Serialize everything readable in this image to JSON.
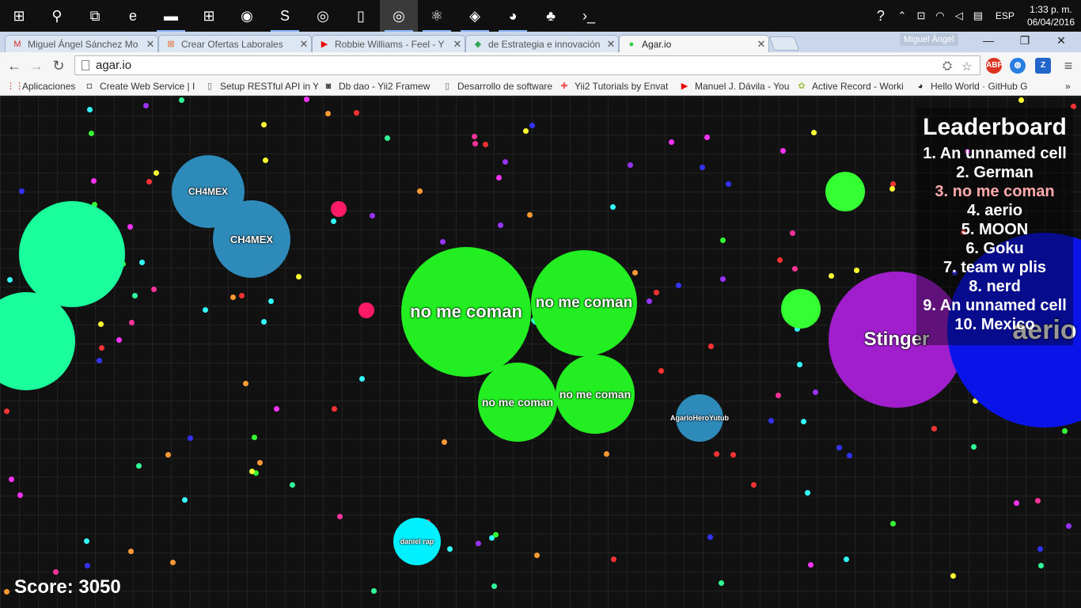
{
  "taskbar": {
    "apps": [
      {
        "name": "windows-start-icon",
        "glyph": "⊞",
        "open": false
      },
      {
        "name": "search-icon",
        "glyph": "⚲",
        "open": false
      },
      {
        "name": "task-view-icon",
        "glyph": "⧉",
        "open": false
      },
      {
        "name": "edge-icon",
        "glyph": "e",
        "open": false
      },
      {
        "name": "file-explorer-icon",
        "glyph": "▬",
        "open": true
      },
      {
        "name": "store-icon",
        "glyph": "⊞",
        "open": false
      },
      {
        "name": "firefox-icon",
        "glyph": "◉",
        "open": false
      },
      {
        "name": "sublime-icon",
        "glyph": "S",
        "open": true
      },
      {
        "name": "chrome-icon",
        "glyph": "◎",
        "open": false
      },
      {
        "name": "document-icon",
        "glyph": "▯",
        "open": false
      },
      {
        "name": "chrome-active-icon",
        "glyph": "◎",
        "open": true
      },
      {
        "name": "atom-icon",
        "glyph": "⚛",
        "open": true
      },
      {
        "name": "mysql-workbench-icon",
        "glyph": "◈",
        "open": true
      },
      {
        "name": "github-desktop-icon",
        "glyph": "◕",
        "open": true
      },
      {
        "name": "clover-icon",
        "glyph": "♣",
        "open": false
      },
      {
        "name": "powershell-icon",
        "glyph": "›_",
        "open": false
      }
    ],
    "lang": "ESP",
    "time": "1:33 p. m.",
    "date": "06/04/2016"
  },
  "tabs": [
    {
      "title": "Miguel Ángel Sánchez Mo",
      "icon": "M",
      "color": "#d93025",
      "active": false
    },
    {
      "title": "Crear Ofertas Laborales",
      "icon": "⊠",
      "color": "#e8733a",
      "active": false
    },
    {
      "title": "Robbie Williams - Feel - Y",
      "icon": "▶",
      "color": "#e00",
      "active": false
    },
    {
      "title": "de Estrategia e innovación",
      "icon": "◆",
      "color": "#34a853",
      "active": false
    },
    {
      "title": "Agar.io",
      "icon": "●",
      "color": "#2ecc40",
      "active": true
    }
  ],
  "profile_name": "Miguel Ángel",
  "url": "agar.io",
  "bookmarks": [
    {
      "label": "Aplicaciones",
      "icon": "⋮⋮",
      "color": "#d93025"
    },
    {
      "label": "Create Web Service | I",
      "icon": "◘",
      "color": "#666"
    },
    {
      "label": "Setup RESTful API in Y",
      "icon": "▯",
      "color": "#666"
    },
    {
      "label": "Db dao - Yii2 Framew",
      "icon": "◙",
      "color": "#333"
    },
    {
      "label": "Desarrollo de software",
      "icon": "▯",
      "color": "#666"
    },
    {
      "label": "Yii2 Tutorials by Envat",
      "icon": "✚",
      "color": "#e55"
    },
    {
      "label": "Manuel J. Dávila - You",
      "icon": "▶",
      "color": "#e00"
    },
    {
      "label": "Active Record - Worki",
      "icon": "✿",
      "color": "#a3c24a"
    },
    {
      "label": "Hello World · GitHub G",
      "icon": "◕",
      "color": "#222"
    }
  ],
  "bookmarks_more": "»",
  "game": {
    "leaderboard_title": "Leaderboard",
    "leaderboard": [
      "1. An unnamed cell",
      "2. German",
      "3. no me coman",
      "4. aerio",
      "5. MOON",
      "6. Goku",
      "7. team w plis",
      "8. nerd",
      "9. An unnamed cell",
      "10. Mexico"
    ],
    "my_rank_index": 2,
    "score": "Score: 3050",
    "player_name": "no me coman",
    "cells": [
      {
        "name": "no me coman",
        "color": "#22ee22",
        "font": 22
      },
      {
        "name": "no me coman",
        "color": "#22ee22",
        "font": 19
      },
      {
        "name": "no me coman",
        "color": "#22ee22",
        "font": 14
      },
      {
        "name": "no me coman",
        "color": "#22ee22",
        "font": 14
      },
      {
        "name": "CH4MEX",
        "color": "#2e8ab8",
        "font": 12
      },
      {
        "name": "CH4MEX",
        "color": "#2e8ab8",
        "font": 13
      },
      {
        "name": "AgarioHeroYutub",
        "color": "#2e8ab8",
        "font": 9
      },
      {
        "name": "daniel rap",
        "color": "#00f0ff",
        "font": 9
      },
      {
        "name": "Stinger",
        "color": "#a01ecc",
        "font": 24
      },
      {
        "name": "aerio",
        "color": "#0a14e8",
        "font": 34
      },
      {
        "name": "",
        "color": "#1aff9c",
        "font": 0
      },
      {
        "name": "",
        "color": "#1aff9c",
        "font": 0
      },
      {
        "name": "",
        "color": "#33ff33",
        "font": 0
      },
      {
        "name": "",
        "color": "#33ff33",
        "font": 0
      },
      {
        "name": "",
        "color": "#ff1a66",
        "font": 0
      },
      {
        "name": "",
        "color": "#ff1a66",
        "font": 0
      }
    ]
  }
}
